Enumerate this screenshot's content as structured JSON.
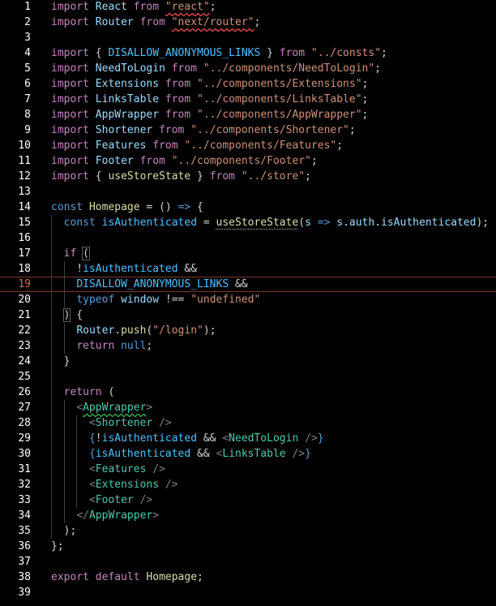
{
  "editor": {
    "current_line": 19,
    "lines": [
      {
        "n": "1",
        "t": [
          [
            "kw",
            "import"
          ],
          [
            "p",
            " "
          ],
          [
            "var",
            "React"
          ],
          [
            "p",
            " "
          ],
          [
            "kw",
            "from"
          ],
          [
            "p",
            " "
          ],
          [
            "str",
            "\"react\"",
            "squig"
          ],
          [
            "p",
            ";"
          ]
        ]
      },
      {
        "n": "2",
        "t": [
          [
            "kw",
            "import"
          ],
          [
            "p",
            " "
          ],
          [
            "var",
            "Router"
          ],
          [
            "p",
            " "
          ],
          [
            "kw",
            "from"
          ],
          [
            "p",
            " "
          ],
          [
            "str",
            "\"next/router\"",
            "squig"
          ],
          [
            "p",
            ";"
          ]
        ]
      },
      {
        "n": "3",
        "t": []
      },
      {
        "n": "4",
        "t": [
          [
            "kw",
            "import"
          ],
          [
            "p",
            " { "
          ],
          [
            "const",
            "DISALLOW_ANONYMOUS_LINKS"
          ],
          [
            "p",
            " } "
          ],
          [
            "kw",
            "from"
          ],
          [
            "p",
            " "
          ],
          [
            "str",
            "\"../consts\""
          ],
          [
            "p",
            ";"
          ]
        ]
      },
      {
        "n": "5",
        "t": [
          [
            "kw",
            "import"
          ],
          [
            "p",
            " "
          ],
          [
            "var",
            "NeedToLogin"
          ],
          [
            "p",
            " "
          ],
          [
            "kw",
            "from"
          ],
          [
            "p",
            " "
          ],
          [
            "str",
            "\"../components/NeedToLogin\""
          ],
          [
            "p",
            ";"
          ]
        ]
      },
      {
        "n": "6",
        "t": [
          [
            "kw",
            "import"
          ],
          [
            "p",
            " "
          ],
          [
            "var",
            "Extensions"
          ],
          [
            "p",
            " "
          ],
          [
            "kw",
            "from"
          ],
          [
            "p",
            " "
          ],
          [
            "str",
            "\"../components/Extensions\""
          ],
          [
            "p",
            ";"
          ]
        ]
      },
      {
        "n": "7",
        "t": [
          [
            "kw",
            "import"
          ],
          [
            "p",
            " "
          ],
          [
            "var",
            "LinksTable"
          ],
          [
            "p",
            " "
          ],
          [
            "kw",
            "from"
          ],
          [
            "p",
            " "
          ],
          [
            "str",
            "\"../components/LinksTable\""
          ],
          [
            "p",
            ";"
          ]
        ]
      },
      {
        "n": "8",
        "t": [
          [
            "kw",
            "import"
          ],
          [
            "p",
            " "
          ],
          [
            "var",
            "AppWrapper"
          ],
          [
            "p",
            " "
          ],
          [
            "kw",
            "from"
          ],
          [
            "p",
            " "
          ],
          [
            "str",
            "\"../components/AppWrapper\""
          ],
          [
            "p",
            ";"
          ]
        ]
      },
      {
        "n": "9",
        "t": [
          [
            "kw",
            "import"
          ],
          [
            "p",
            " "
          ],
          [
            "var",
            "Shortener"
          ],
          [
            "p",
            " "
          ],
          [
            "kw",
            "from"
          ],
          [
            "p",
            " "
          ],
          [
            "str",
            "\"../components/Shortener\""
          ],
          [
            "p",
            ";"
          ]
        ]
      },
      {
        "n": "10",
        "t": [
          [
            "kw",
            "import"
          ],
          [
            "p",
            " "
          ],
          [
            "var",
            "Features"
          ],
          [
            "p",
            " "
          ],
          [
            "kw",
            "from"
          ],
          [
            "p",
            " "
          ],
          [
            "str",
            "\"../components/Features\""
          ],
          [
            "p",
            ";"
          ]
        ]
      },
      {
        "n": "11",
        "t": [
          [
            "kw",
            "import"
          ],
          [
            "p",
            " "
          ],
          [
            "var",
            "Footer"
          ],
          [
            "p",
            " "
          ],
          [
            "kw",
            "from"
          ],
          [
            "p",
            " "
          ],
          [
            "str",
            "\"../components/Footer\""
          ],
          [
            "p",
            ";"
          ]
        ]
      },
      {
        "n": "12",
        "t": [
          [
            "kw",
            "import"
          ],
          [
            "p",
            " { "
          ],
          [
            "fn",
            "useStoreState"
          ],
          [
            "p",
            " } "
          ],
          [
            "kw",
            "from"
          ],
          [
            "p",
            " "
          ],
          [
            "str",
            "\"../store\""
          ],
          [
            "p",
            ";"
          ]
        ]
      },
      {
        "n": "13",
        "t": []
      },
      {
        "n": "14",
        "t": [
          [
            "kwb",
            "const"
          ],
          [
            "p",
            " "
          ],
          [
            "fn",
            "Homepage"
          ],
          [
            "p",
            " = () "
          ],
          [
            "kwb",
            "=>"
          ],
          [
            "p",
            " {"
          ]
        ]
      },
      {
        "n": "15",
        "t": [
          [
            "p",
            "  "
          ],
          [
            "kwb",
            "const"
          ],
          [
            "p",
            " "
          ],
          [
            "const",
            "isAuthenticated"
          ],
          [
            "p",
            " = "
          ],
          [
            "fn",
            "useStoreState",
            "dots"
          ],
          [
            "p",
            "("
          ],
          [
            "var",
            "s"
          ],
          [
            "p",
            " "
          ],
          [
            "kwb",
            "=>"
          ],
          [
            "p",
            " "
          ],
          [
            "var",
            "s"
          ],
          [
            "p",
            "."
          ],
          [
            "var",
            "auth"
          ],
          [
            "p",
            "."
          ],
          [
            "var",
            "isAuthenticated"
          ],
          [
            "p",
            ");"
          ]
        ]
      },
      {
        "n": "16",
        "t": []
      },
      {
        "n": "17",
        "t": [
          [
            "p",
            "  "
          ],
          [
            "kw",
            "if"
          ],
          [
            "p",
            " "
          ],
          [
            "p",
            "(",
            "box"
          ]
        ]
      },
      {
        "n": "18",
        "t": [
          [
            "p",
            "    !"
          ],
          [
            "const",
            "isAuthenticated"
          ],
          [
            "p",
            " &&"
          ]
        ]
      },
      {
        "n": "19",
        "t": [
          [
            "p",
            "    "
          ],
          [
            "const",
            "DISALLOW_ANONYMOUS_LINKS"
          ],
          [
            "p",
            " &&"
          ]
        ]
      },
      {
        "n": "20",
        "t": [
          [
            "p",
            "    "
          ],
          [
            "kwb",
            "typeof"
          ],
          [
            "p",
            " "
          ],
          [
            "var",
            "window"
          ],
          [
            "p",
            " !== "
          ],
          [
            "str",
            "\"undefined\""
          ]
        ]
      },
      {
        "n": "21",
        "t": [
          [
            "p",
            "  "
          ],
          [
            "p",
            ")",
            "box"
          ],
          [
            "p",
            " {"
          ]
        ]
      },
      {
        "n": "22",
        "t": [
          [
            "p",
            "    "
          ],
          [
            "var",
            "Router"
          ],
          [
            "p",
            "."
          ],
          [
            "fn",
            "push"
          ],
          [
            "p",
            "("
          ],
          [
            "str",
            "\"/login\""
          ],
          [
            "p",
            ");"
          ]
        ]
      },
      {
        "n": "23",
        "t": [
          [
            "p",
            "    "
          ],
          [
            "kw",
            "return"
          ],
          [
            "p",
            " "
          ],
          [
            "kwb",
            "null"
          ],
          [
            "p",
            ";"
          ]
        ]
      },
      {
        "n": "24",
        "t": [
          [
            "p",
            "  }"
          ]
        ]
      },
      {
        "n": "25",
        "t": []
      },
      {
        "n": "26",
        "t": [
          [
            "p",
            "  "
          ],
          [
            "kw",
            "return"
          ],
          [
            "p",
            " ("
          ]
        ]
      },
      {
        "n": "27",
        "t": [
          [
            "p",
            "    "
          ],
          [
            "punc",
            "<"
          ],
          [
            "tag",
            "AppWrapper",
            "squigg"
          ],
          [
            "punc",
            ">"
          ]
        ]
      },
      {
        "n": "28",
        "t": [
          [
            "p",
            "      "
          ],
          [
            "punc",
            "<"
          ],
          [
            "tag",
            "Shortener"
          ],
          [
            "p",
            " "
          ],
          [
            "punc",
            "/>"
          ]
        ]
      },
      {
        "n": "29",
        "t": [
          [
            "p",
            "      "
          ],
          [
            "kwb",
            "{"
          ],
          [
            "p",
            "!"
          ],
          [
            "const",
            "isAuthenticated"
          ],
          [
            "p",
            " && "
          ],
          [
            "punc",
            "<"
          ],
          [
            "tag",
            "NeedToLogin"
          ],
          [
            "p",
            " "
          ],
          [
            "punc",
            "/>"
          ],
          [
            "kwb",
            "}"
          ]
        ]
      },
      {
        "n": "30",
        "t": [
          [
            "p",
            "      "
          ],
          [
            "kwb",
            "{"
          ],
          [
            "const",
            "isAuthenticated"
          ],
          [
            "p",
            " && "
          ],
          [
            "punc",
            "<"
          ],
          [
            "tag",
            "LinksTable"
          ],
          [
            "p",
            " "
          ],
          [
            "punc",
            "/>"
          ],
          [
            "kwb",
            "}"
          ]
        ]
      },
      {
        "n": "31",
        "t": [
          [
            "p",
            "      "
          ],
          [
            "punc",
            "<"
          ],
          [
            "tag",
            "Features"
          ],
          [
            "p",
            " "
          ],
          [
            "punc",
            "/>"
          ]
        ]
      },
      {
        "n": "32",
        "t": [
          [
            "p",
            "      "
          ],
          [
            "punc",
            "<"
          ],
          [
            "tag",
            "Extensions"
          ],
          [
            "p",
            " "
          ],
          [
            "punc",
            "/>"
          ]
        ]
      },
      {
        "n": "33",
        "t": [
          [
            "p",
            "      "
          ],
          [
            "punc",
            "<"
          ],
          [
            "tag",
            "Footer"
          ],
          [
            "p",
            " "
          ],
          [
            "punc",
            "/>"
          ]
        ]
      },
      {
        "n": "34",
        "t": [
          [
            "p",
            "    "
          ],
          [
            "punc",
            "</"
          ],
          [
            "tag",
            "AppWrapper"
          ],
          [
            "punc",
            ">"
          ]
        ]
      },
      {
        "n": "35",
        "t": [
          [
            "p",
            "  );"
          ]
        ]
      },
      {
        "n": "36",
        "t": [
          [
            "p",
            "};"
          ]
        ]
      },
      {
        "n": "37",
        "t": []
      },
      {
        "n": "38",
        "t": [
          [
            "kw",
            "export"
          ],
          [
            "p",
            " "
          ],
          [
            "kw",
            "default"
          ],
          [
            "p",
            " "
          ],
          [
            "fn",
            "Homepage"
          ],
          [
            "p",
            ";"
          ]
        ]
      },
      {
        "n": "39",
        "t": []
      }
    ]
  },
  "colors": {
    "background": "#000000",
    "keyword_control": "#c586c0",
    "keyword": "#569cd6",
    "string": "#ce9178",
    "variable": "#9cdcfe",
    "function": "#dcdcaa",
    "constant": "#4fc1ff",
    "jsx_tag": "#4ec9b0",
    "current_line_border": "#7a3a2a"
  }
}
